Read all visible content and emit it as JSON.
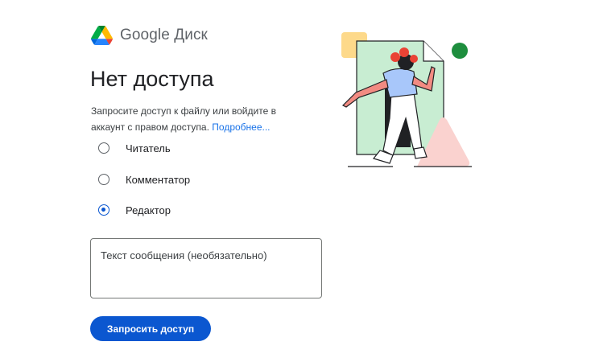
{
  "brand": {
    "google": "Google",
    "product": "Диск",
    "logo_icon": "google-drive-icon"
  },
  "page": {
    "title": "Нет доступа",
    "description": "Запросите доступ к файлу или войдите в аккаунт с правом доступа.",
    "learn_more": "Подробнее..."
  },
  "roles": {
    "selected": "editor",
    "options": [
      {
        "id": "viewer",
        "label": "Читатель",
        "checked": false
      },
      {
        "id": "commenter",
        "label": "Комментатор",
        "checked": false
      },
      {
        "id": "editor",
        "label": "Редактор",
        "checked": true
      }
    ]
  },
  "message": {
    "value": "",
    "placeholder": "Текст сообщения (необязательно)"
  },
  "actions": {
    "request_label": "Запросить доступ"
  },
  "illustration": {
    "icon": "person-leaving-document-illustration"
  },
  "colors": {
    "primary": "#0b57d0",
    "link": "#1a73e8",
    "text": "#202124",
    "muted": "#5f6368"
  }
}
